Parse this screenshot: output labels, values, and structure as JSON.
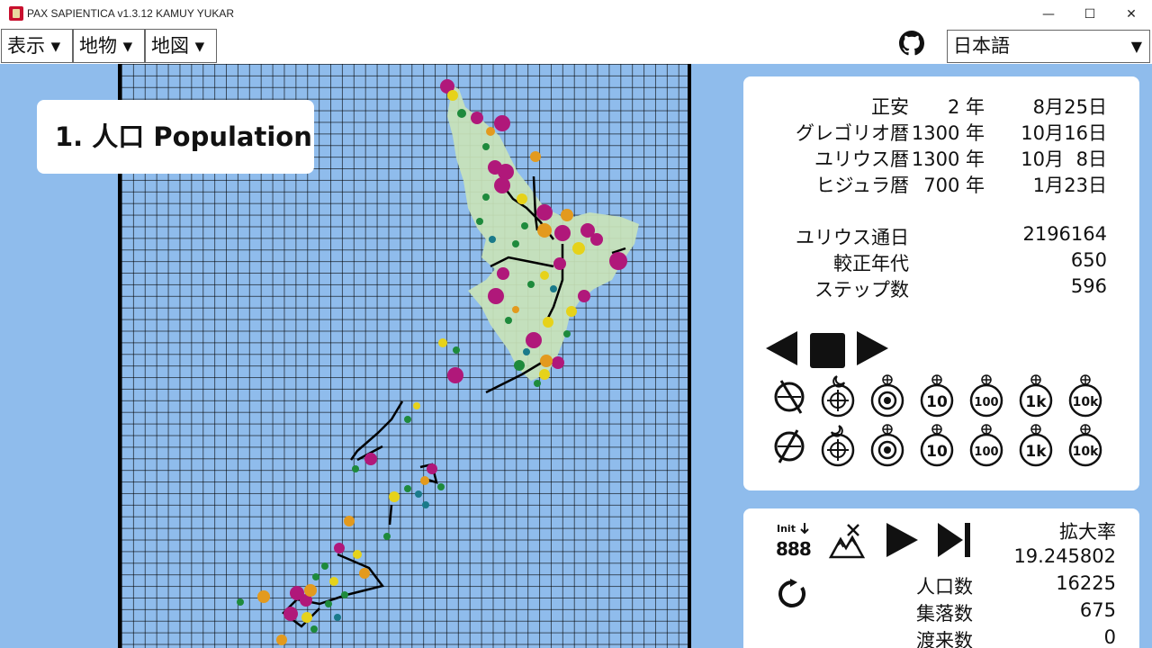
{
  "window": {
    "title": "PAX SAPIENTICA v1.3.12 KAMUY YUKAR",
    "minimize": "—",
    "maximize": "☐",
    "close": "✕"
  },
  "menu": {
    "display": "表示 ▾",
    "features": "地物 ▾",
    "map": "地図 ▾"
  },
  "language": {
    "selected": "日本語",
    "arrow": "▼"
  },
  "layer_label": "1. 人口 Population",
  "calendar": [
    {
      "label": "正安",
      "year": "2 年",
      "month": "8月",
      "day": "25日"
    },
    {
      "label": "グレゴリオ暦",
      "year": "1300 年",
      "month": "10月",
      "day": "16日"
    },
    {
      "label": "ユリウス暦",
      "year": "1300 年",
      "month": "10月",
      "day": "8日"
    },
    {
      "label": "ヒジュラ暦",
      "year": "700 年",
      "month": "1月",
      "day": "23日"
    }
  ],
  "counters": [
    {
      "label": "ユリウス通日",
      "value": "2196164"
    },
    {
      "label": "較正年代",
      "value": "650"
    },
    {
      "label": "ステップ数",
      "value": "596"
    }
  ],
  "speed_labels": [
    "",
    "",
    "",
    "10",
    "100",
    "1k",
    "10k"
  ],
  "status": {
    "init_label": "Init",
    "init_digits": "888",
    "zoom_label": "拡大率",
    "zoom_value": "19.245802",
    "stats": [
      {
        "label": "人口数",
        "value": "16225"
      },
      {
        "label": "集落数",
        "value": "675"
      },
      {
        "label": "渡来数",
        "value": "0"
      }
    ]
  },
  "colors": {
    "background": "#8fbcec",
    "land": "#c9e3b8",
    "settlement_magenta": "#b0187a",
    "settlement_orange": "#e39a1e",
    "settlement_yellow": "#e6d21a",
    "settlement_green": "#1e8a3c",
    "settlement_teal": "#1a7a8a"
  }
}
